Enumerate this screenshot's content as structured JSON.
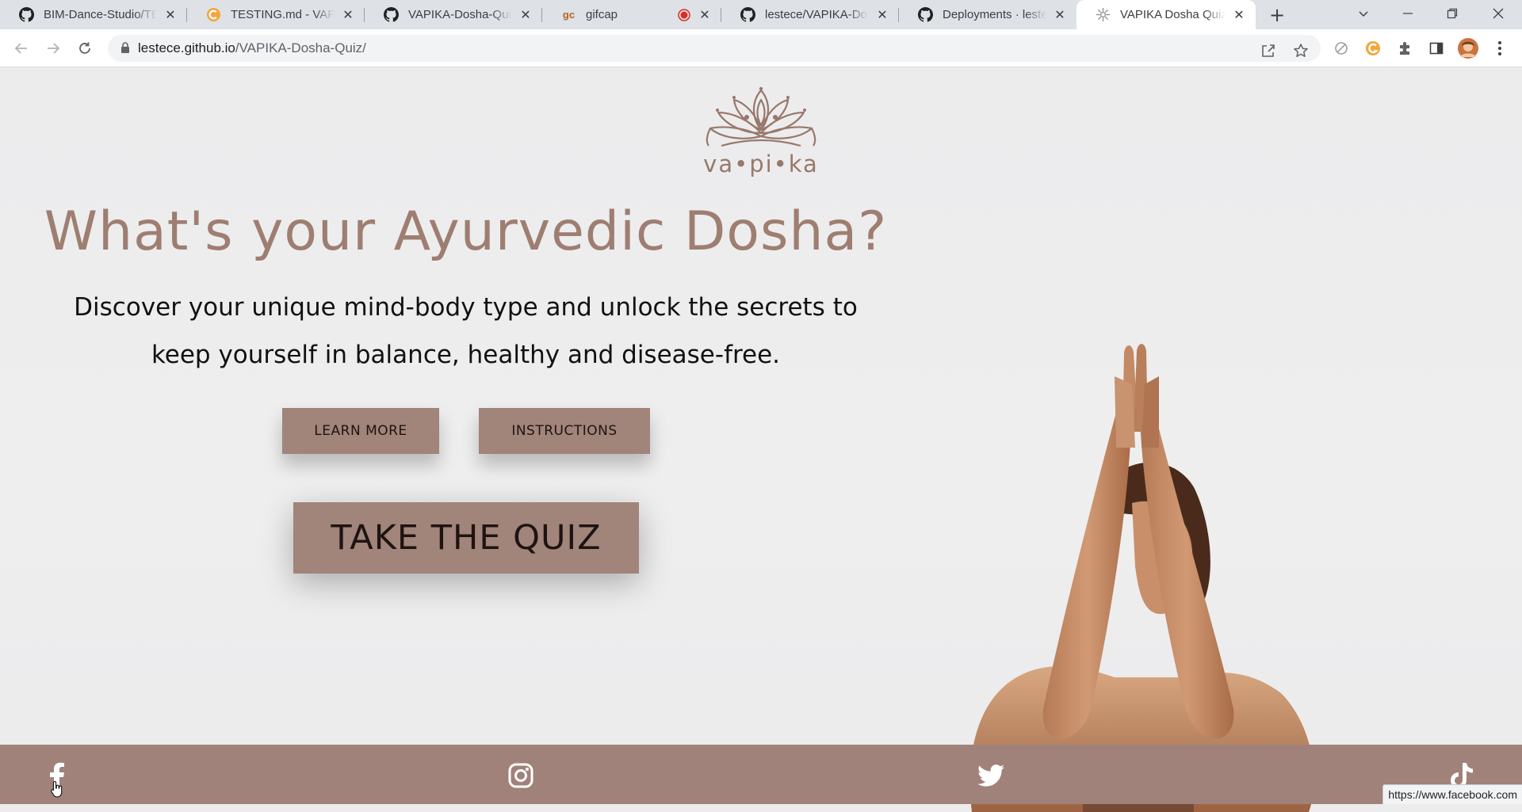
{
  "browser": {
    "tabs": [
      {
        "title": "BIM-Dance-Studio/TE",
        "icon": "github-icon"
      },
      {
        "title": "TESTING.md - VAPIKA",
        "icon": "gitbook-icon"
      },
      {
        "title": "VAPIKA-Dosha-Quiz/T",
        "icon": "github-icon"
      },
      {
        "title": "gifcap",
        "icon": "gifcap-icon",
        "icon_text": "gc"
      },
      {
        "title": "lestece/VAPIKA-Dosh",
        "icon": "github-icon"
      },
      {
        "title": "Deployments · lestece",
        "icon": "github-icon"
      },
      {
        "title": "VAPIKA Dosha Quiz",
        "icon": "vapika-icon",
        "active": true
      }
    ],
    "url_host": "lestece.github.io",
    "url_path": "/VAPIKA-Dosha-Quiz/",
    "status_url": "https://www.facebook.com"
  },
  "page": {
    "logo_text": "va•pi•ka",
    "headline": "What's your Ayurvedic Dosha?",
    "intro_line1": "Discover your unique mind-body type and unlock the secrets to",
    "intro_line2": "keep yourself in balance, healthy and disease-free.",
    "learn_more": "LEARN MORE",
    "instructions": "INSTRUCTIONS",
    "take_quiz": "TAKE THE QUIZ"
  },
  "footer": {
    "social": [
      "facebook-icon",
      "instagram-icon",
      "twitter-icon",
      "tiktok-icon"
    ]
  },
  "colors": {
    "brand": "#a0827a",
    "headline": "#9f7e72",
    "background": "#ececed"
  }
}
